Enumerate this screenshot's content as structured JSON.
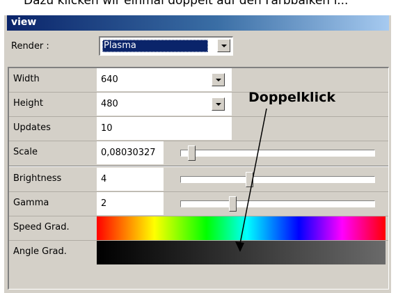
{
  "caption": "Dazu klicken wir einmal doppelt auf den Farbbalken f...",
  "window": {
    "title": "view"
  },
  "render": {
    "label": "Render :",
    "value": "Plasma"
  },
  "properties": [
    {
      "label": "Width",
      "value": "640"
    },
    {
      "label": "Height",
      "value": "480"
    },
    {
      "label": "Updates",
      "value": "10"
    },
    {
      "label": "Scale",
      "value": "0,08030327",
      "slider_fraction": 0.04
    }
  ],
  "appearance": [
    {
      "label": "Brightness",
      "value": "4",
      "slider_fraction": 0.35
    },
    {
      "label": "Gamma",
      "value": "2",
      "slider_fraction": 0.26
    },
    {
      "label": "Speed Grad."
    },
    {
      "label": "Angle Grad."
    }
  ],
  "annotation": {
    "text": "Doppelklick"
  }
}
